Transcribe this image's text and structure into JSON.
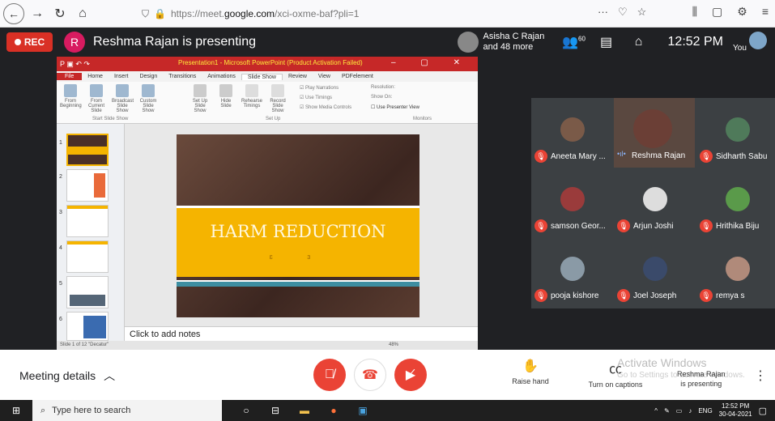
{
  "browser": {
    "url_prefix": "https://meet.",
    "url_domain": "google.com",
    "url_path": "/xci-oxme-baf?pli=1",
    "icons": [
      "back-icon",
      "forward-icon",
      "reload-icon",
      "home-icon",
      "shield-icon",
      "lock-icon"
    ]
  },
  "meet_top": {
    "rec_label": "REC",
    "presenter_initial": "R",
    "presenting_title": "Reshma Rajan is presenting",
    "presenters_line1": "Asisha C Rajan",
    "presenters_line2": "and 48 more",
    "participants_count": "60",
    "time": "12:52 PM",
    "you_label": "You"
  },
  "presentation": {
    "window_title": "Presentation1 - Microsoft PowerPoint (Product Activation Failed)",
    "tabs": [
      "File",
      "Home",
      "Insert",
      "Design",
      "Transitions",
      "Animations",
      "Slide Show",
      "Review",
      "View",
      "PDFelement"
    ],
    "ribbon": {
      "from_beginning": "From Beginning",
      "from_current": "From Current Slide",
      "broadcast": "Broadcast Slide Show",
      "custom": "Custom Slide Show",
      "start_group": "Start Slide Show",
      "set_up": "Set Up Slide Show",
      "hide": "Hide Slide",
      "rehearse": "Rehearse Timings",
      "record": "Record Slide Show",
      "setup_group": "Set Up",
      "play_narrations": "Play Narrations",
      "use_timings": "Use Timings",
      "show_media": "Show Media Controls",
      "resolution": "Resolution:",
      "show_on": "Show On:",
      "presenter_view": "Use Presenter View",
      "monitors_group": "Monitors"
    },
    "slide_title": "HARM REDUCTION",
    "notes_placeholder": "Click to add notes",
    "status": "Slide 1 of 12   \"Decatur\"",
    "zoom": "48%",
    "thumb_numbers": [
      "1",
      "2",
      "3",
      "4",
      "5",
      "6"
    ]
  },
  "participants": [
    {
      "name": "Aneeta Mary ...",
      "muted": true
    },
    {
      "name": "Reshma Rajan",
      "muted": false
    },
    {
      "name": "Sidharth Sabu",
      "muted": true
    },
    {
      "name": "samson Geor...",
      "muted": true
    },
    {
      "name": "Arjun Joshi",
      "muted": true
    },
    {
      "name": "Hrithika Biju",
      "muted": true
    },
    {
      "name": "pooja kishore",
      "muted": true
    },
    {
      "name": "Joel Joseph",
      "muted": true
    },
    {
      "name": "remya s",
      "muted": true
    }
  ],
  "controls": {
    "meeting_details": "Meeting details",
    "raise_hand": "Raise hand",
    "captions": "Turn on captions",
    "activate_windows": "Activate Windows",
    "activate_sub": "Go to Settings to activate Windows.",
    "presenting_line1": "Reshma Rajan",
    "presenting_line2": "is presenting"
  },
  "taskbar": {
    "search_placeholder": "Type here to search",
    "lang": "ENG",
    "time": "12:52 PM",
    "date": "30-04-2021"
  },
  "colors": {
    "rec_red": "#d93025",
    "end_red": "#ea4335",
    "ppt_red": "#c62828",
    "slide_band": "#f5b400"
  }
}
